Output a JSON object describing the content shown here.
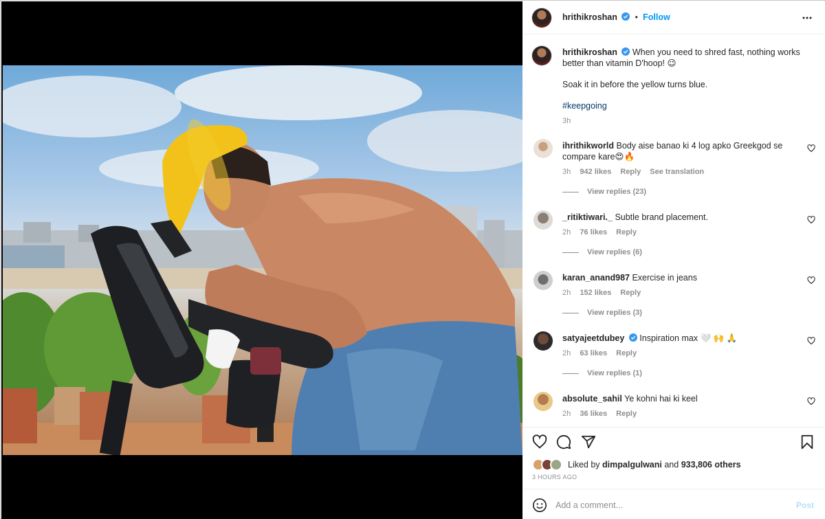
{
  "post": {
    "author": "hrithikroshan",
    "follow_label": "Follow",
    "dot": "•",
    "caption_line1": "When you need to shred fast, nothing works better than vitamin D'hoop! 😉",
    "caption_line2": "Soak it in before the yellow turns blue.",
    "hashtag": "#keepgoing",
    "time": "3h",
    "liked_by_prefix": "Liked by",
    "liked_by_user": "dimpalgulwani",
    "liked_by_suffix": "and",
    "liked_by_count": "933,806 others",
    "time_ago": "3 HOURS AGO"
  },
  "comments": [
    {
      "user": "ihrithikworld",
      "text": "Body aise banao ki 4 log apko Greekgod se compare kare😍🔥",
      "time": "3h",
      "likes": "942 likes",
      "reply": "Reply",
      "translate": "See translation",
      "view_replies": "View replies (23)"
    },
    {
      "user": "_ritiktiwari._",
      "text": "Subtle brand placement.",
      "time": "2h",
      "likes": "76 likes",
      "reply": "Reply",
      "view_replies": "View replies (6)"
    },
    {
      "user": "karan_anand987",
      "text": "Exercise in jeans",
      "time": "2h",
      "likes": "152 likes",
      "reply": "Reply",
      "view_replies": "View replies (3)"
    },
    {
      "user": "satyajeetdubey",
      "text": "Inspiration max 🤍 🙌 🙏",
      "time": "2h",
      "likes": "63 likes",
      "reply": "Reply",
      "view_replies": "View replies (1)"
    },
    {
      "user": "absolute_sahil",
      "text": "Ye kohni hai ki keel",
      "time": "2h",
      "likes": "36 likes",
      "reply": "Reply"
    }
  ],
  "composer": {
    "placeholder": "Add a comment...",
    "post_label": "Post"
  },
  "colors": {
    "link_blue": "#0095f6",
    "hashtag": "#00376b",
    "muted": "#8e8e8e",
    "post_disabled": "#b2dffc",
    "cap_yellow": "#f2c21a",
    "jeans_blue": "#4f7fb0"
  },
  "icons": [
    "verified-icon",
    "more-options-icon",
    "heart-icon",
    "comment-icon",
    "share-icon",
    "save-icon",
    "emoji-icon"
  ]
}
